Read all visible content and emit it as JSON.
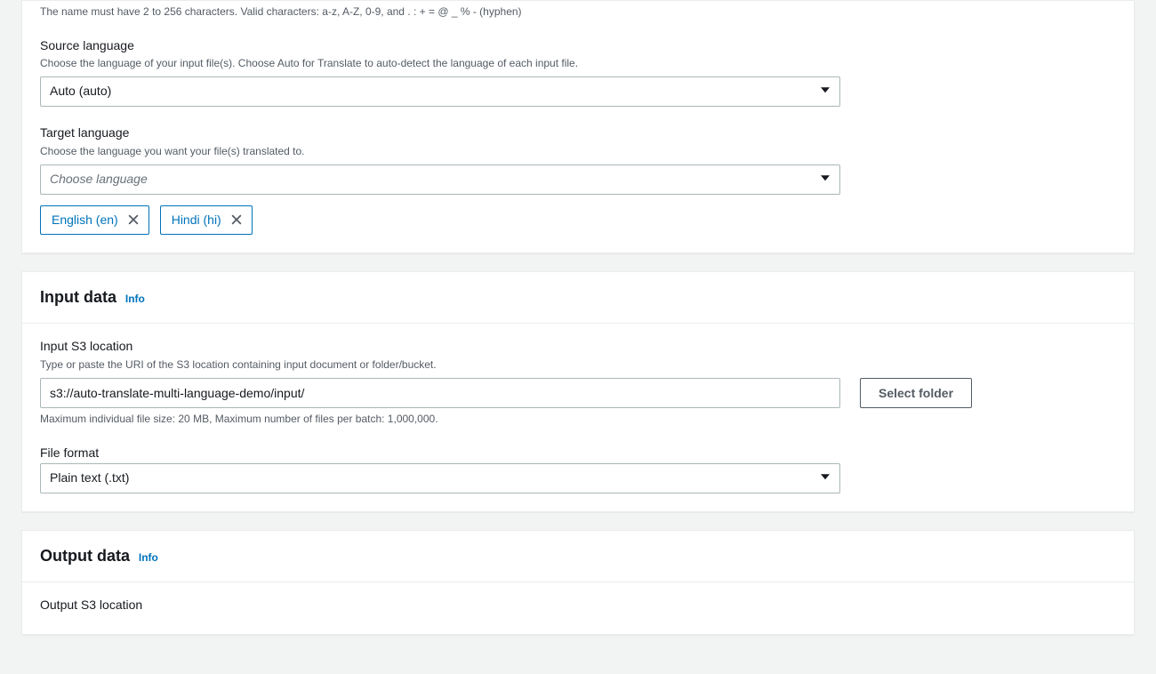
{
  "job": {
    "name_constraint": "The name must have 2 to 256 characters. Valid characters: a-z, A-Z, 0-9, and . : + = @ _ % - (hyphen)",
    "source_language": {
      "label": "Source language",
      "desc": "Choose the language of your input file(s). Choose Auto for Translate to auto-detect the language of each input file.",
      "value": "Auto (auto)"
    },
    "target_language": {
      "label": "Target language",
      "desc": "Choose the language you want your file(s) translated to.",
      "placeholder": "Choose language",
      "selected": [
        {
          "label": "English (en)"
        },
        {
          "label": "Hindi (hi)"
        }
      ]
    }
  },
  "input_data": {
    "title": "Input data",
    "info": "Info",
    "s3": {
      "label": "Input S3 location",
      "desc": "Type or paste the URI of the S3 location containing input document or folder/bucket.",
      "value": "s3://auto-translate-multi-language-demo/input/",
      "constraint": "Maximum individual file size: 20 MB, Maximum number of files per batch: 1,000,000.",
      "select_folder": "Select folder"
    },
    "file_format": {
      "label": "File format",
      "value": "Plain text (.txt)"
    }
  },
  "output_data": {
    "title": "Output data",
    "info": "Info",
    "s3": {
      "label": "Output S3 location"
    }
  }
}
